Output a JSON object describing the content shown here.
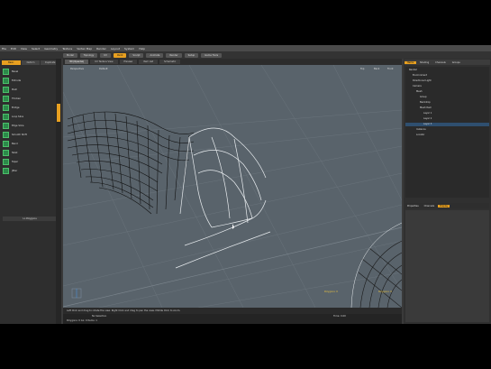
{
  "menu": [
    "File",
    "Edit",
    "View",
    "Select",
    "Geometry",
    "Texture",
    "Vertex Map",
    "Render",
    "Layout",
    "System",
    "Help"
  ],
  "toolbar": [
    "Model",
    "Topology",
    "UV",
    "Paint",
    "Sculpt",
    "Animate",
    "Render",
    "Setup",
    "Game Tools"
  ],
  "toolbar_active_index": 3,
  "left_panel": {
    "tabs": [
      "Basic",
      "Deform",
      "Duplicate"
    ],
    "active_tab": 0,
    "tools": [
      "Bevel",
      "Extrude",
      "Push",
      "Thicken",
      "Bridge",
      "Loop Slice",
      "Edge Slice",
      "Smooth Shift",
      "Bend",
      "Twist",
      "Taper",
      "Jitter"
    ],
    "button": "Lo Polygons"
  },
  "viewport": {
    "tabs": [
      "3D (OpenGL)",
      "UV Texture View",
      "Preview",
      "Item List",
      "Schematic"
    ],
    "active_tab": 0,
    "label_left": "Perspective",
    "label_right": "Default",
    "corner_labels": [
      "Top",
      "Back",
      "Front"
    ],
    "bottom_left_label": "Polygons: 0",
    "bottom_right_label": "Polygons: 0"
  },
  "hint_bar": "Left Click and drag to rotate the view. Right Click and drag to pan the view. Middle Click to zoom.",
  "status": {
    "left": "No Selection",
    "mid": "Polygons: 0  GL: 0  Items: 1",
    "right": "Time: 0.00"
  },
  "right_panel": {
    "tabs": [
      "Items",
      "Shading",
      "Channels",
      "Groups"
    ],
    "active_tab": 0,
    "tree": [
      "Render",
      "Environment",
      "Directional Light",
      "Camera",
      "Mesh",
      "Group",
      "Backdrop",
      "Mesh Item",
      "Layer 1",
      "Layer 2",
      "Layer 3",
      "Instance",
      "Locator"
    ],
    "selected_index": 8,
    "prop_tabs": [
      "Properties",
      "Channels",
      "Display"
    ],
    "prop_active": 0
  },
  "colors": {
    "viewport_bg": "#59636b",
    "accent": "#e8a020",
    "panel": "#303030"
  }
}
